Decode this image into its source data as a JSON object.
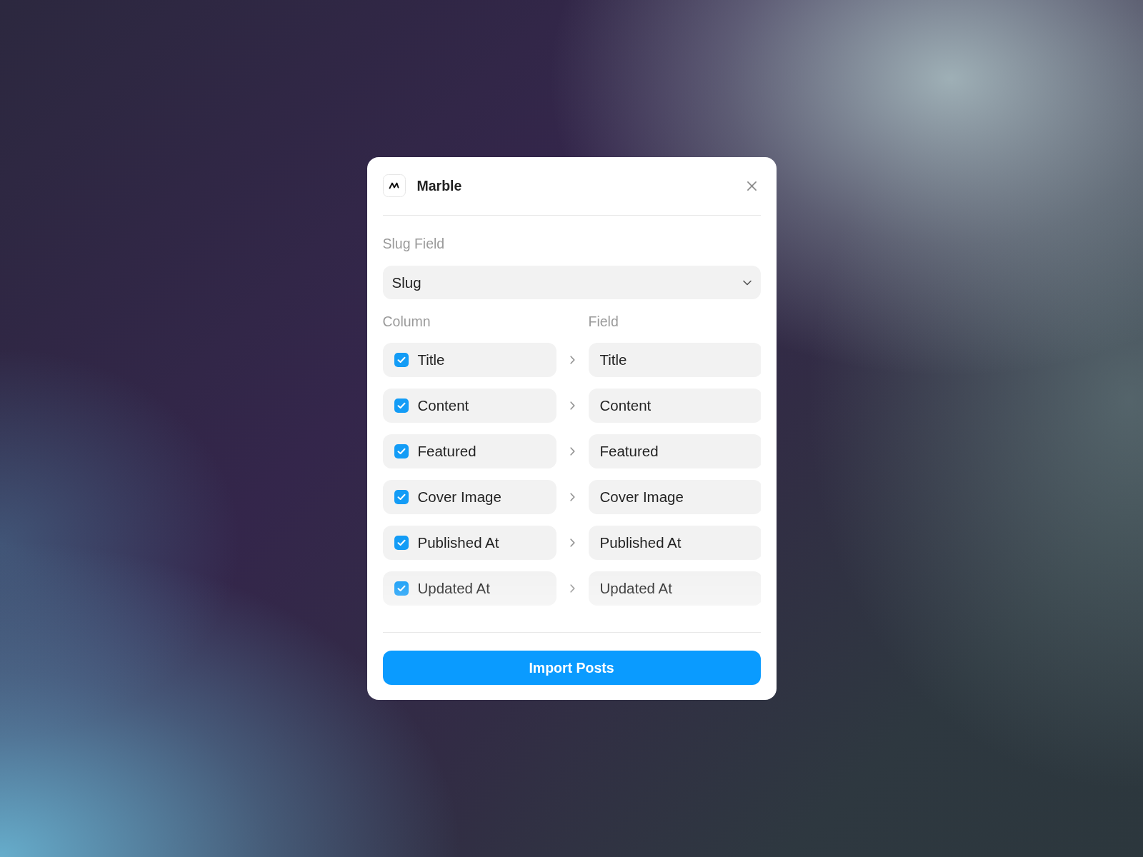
{
  "dialog": {
    "title": "Marble"
  },
  "slug_field": {
    "label": "Slug Field",
    "value": "Slug"
  },
  "mapping": {
    "column_header": "Column",
    "field_header": "Field",
    "rows": [
      {
        "column": "Title",
        "checked": true,
        "field": "Title"
      },
      {
        "column": "Content",
        "checked": true,
        "field": "Content"
      },
      {
        "column": "Featured",
        "checked": true,
        "field": "Featured"
      },
      {
        "column": "Cover Image",
        "checked": true,
        "field": "Cover Image"
      },
      {
        "column": "Published At",
        "checked": true,
        "field": "Published At"
      },
      {
        "column": "Updated At",
        "checked": true,
        "field": "Updated At"
      }
    ]
  },
  "import_button": {
    "label": "Import Posts"
  }
}
